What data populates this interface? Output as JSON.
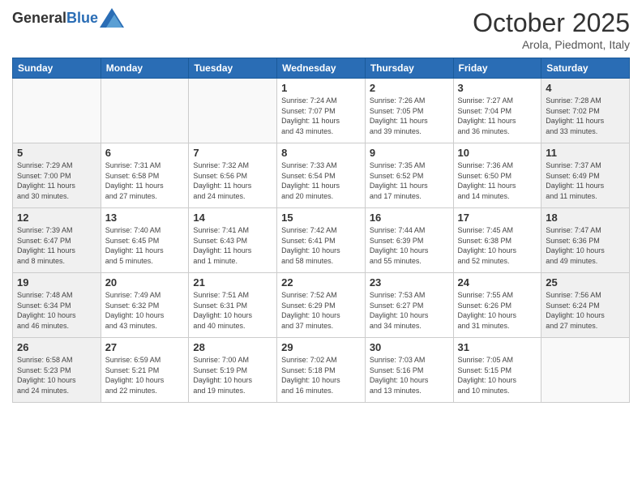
{
  "header": {
    "logo_general": "General",
    "logo_blue": "Blue",
    "month_title": "October 2025",
    "location": "Arola, Piedmont, Italy"
  },
  "days_of_week": [
    "Sunday",
    "Monday",
    "Tuesday",
    "Wednesday",
    "Thursday",
    "Friday",
    "Saturday"
  ],
  "weeks": [
    [
      {
        "day": "",
        "info": ""
      },
      {
        "day": "",
        "info": ""
      },
      {
        "day": "",
        "info": ""
      },
      {
        "day": "1",
        "info": "Sunrise: 7:24 AM\nSunset: 7:07 PM\nDaylight: 11 hours\nand 43 minutes."
      },
      {
        "day": "2",
        "info": "Sunrise: 7:26 AM\nSunset: 7:05 PM\nDaylight: 11 hours\nand 39 minutes."
      },
      {
        "day": "3",
        "info": "Sunrise: 7:27 AM\nSunset: 7:04 PM\nDaylight: 11 hours\nand 36 minutes."
      },
      {
        "day": "4",
        "info": "Sunrise: 7:28 AM\nSunset: 7:02 PM\nDaylight: 11 hours\nand 33 minutes."
      }
    ],
    [
      {
        "day": "5",
        "info": "Sunrise: 7:29 AM\nSunset: 7:00 PM\nDaylight: 11 hours\nand 30 minutes."
      },
      {
        "day": "6",
        "info": "Sunrise: 7:31 AM\nSunset: 6:58 PM\nDaylight: 11 hours\nand 27 minutes."
      },
      {
        "day": "7",
        "info": "Sunrise: 7:32 AM\nSunset: 6:56 PM\nDaylight: 11 hours\nand 24 minutes."
      },
      {
        "day": "8",
        "info": "Sunrise: 7:33 AM\nSunset: 6:54 PM\nDaylight: 11 hours\nand 20 minutes."
      },
      {
        "day": "9",
        "info": "Sunrise: 7:35 AM\nSunset: 6:52 PM\nDaylight: 11 hours\nand 17 minutes."
      },
      {
        "day": "10",
        "info": "Sunrise: 7:36 AM\nSunset: 6:50 PM\nDaylight: 11 hours\nand 14 minutes."
      },
      {
        "day": "11",
        "info": "Sunrise: 7:37 AM\nSunset: 6:49 PM\nDaylight: 11 hours\nand 11 minutes."
      }
    ],
    [
      {
        "day": "12",
        "info": "Sunrise: 7:39 AM\nSunset: 6:47 PM\nDaylight: 11 hours\nand 8 minutes."
      },
      {
        "day": "13",
        "info": "Sunrise: 7:40 AM\nSunset: 6:45 PM\nDaylight: 11 hours\nand 5 minutes."
      },
      {
        "day": "14",
        "info": "Sunrise: 7:41 AM\nSunset: 6:43 PM\nDaylight: 11 hours\nand 1 minute."
      },
      {
        "day": "15",
        "info": "Sunrise: 7:42 AM\nSunset: 6:41 PM\nDaylight: 10 hours\nand 58 minutes."
      },
      {
        "day": "16",
        "info": "Sunrise: 7:44 AM\nSunset: 6:39 PM\nDaylight: 10 hours\nand 55 minutes."
      },
      {
        "day": "17",
        "info": "Sunrise: 7:45 AM\nSunset: 6:38 PM\nDaylight: 10 hours\nand 52 minutes."
      },
      {
        "day": "18",
        "info": "Sunrise: 7:47 AM\nSunset: 6:36 PM\nDaylight: 10 hours\nand 49 minutes."
      }
    ],
    [
      {
        "day": "19",
        "info": "Sunrise: 7:48 AM\nSunset: 6:34 PM\nDaylight: 10 hours\nand 46 minutes."
      },
      {
        "day": "20",
        "info": "Sunrise: 7:49 AM\nSunset: 6:32 PM\nDaylight: 10 hours\nand 43 minutes."
      },
      {
        "day": "21",
        "info": "Sunrise: 7:51 AM\nSunset: 6:31 PM\nDaylight: 10 hours\nand 40 minutes."
      },
      {
        "day": "22",
        "info": "Sunrise: 7:52 AM\nSunset: 6:29 PM\nDaylight: 10 hours\nand 37 minutes."
      },
      {
        "day": "23",
        "info": "Sunrise: 7:53 AM\nSunset: 6:27 PM\nDaylight: 10 hours\nand 34 minutes."
      },
      {
        "day": "24",
        "info": "Sunrise: 7:55 AM\nSunset: 6:26 PM\nDaylight: 10 hours\nand 31 minutes."
      },
      {
        "day": "25",
        "info": "Sunrise: 7:56 AM\nSunset: 6:24 PM\nDaylight: 10 hours\nand 27 minutes."
      }
    ],
    [
      {
        "day": "26",
        "info": "Sunrise: 6:58 AM\nSunset: 5:23 PM\nDaylight: 10 hours\nand 24 minutes."
      },
      {
        "day": "27",
        "info": "Sunrise: 6:59 AM\nSunset: 5:21 PM\nDaylight: 10 hours\nand 22 minutes."
      },
      {
        "day": "28",
        "info": "Sunrise: 7:00 AM\nSunset: 5:19 PM\nDaylight: 10 hours\nand 19 minutes."
      },
      {
        "day": "29",
        "info": "Sunrise: 7:02 AM\nSunset: 5:18 PM\nDaylight: 10 hours\nand 16 minutes."
      },
      {
        "day": "30",
        "info": "Sunrise: 7:03 AM\nSunset: 5:16 PM\nDaylight: 10 hours\nand 13 minutes."
      },
      {
        "day": "31",
        "info": "Sunrise: 7:05 AM\nSunset: 5:15 PM\nDaylight: 10 hours\nand 10 minutes."
      },
      {
        "day": "",
        "info": ""
      }
    ]
  ]
}
